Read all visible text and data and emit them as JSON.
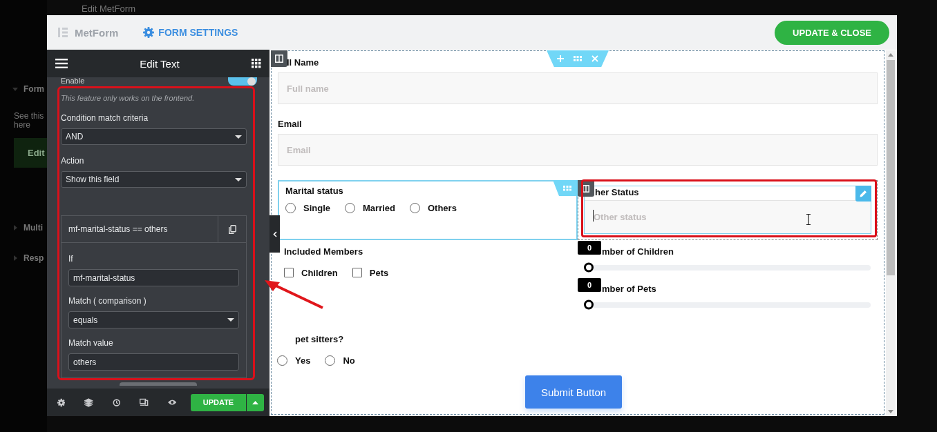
{
  "backdrop": {
    "title": "Edit MetForm",
    "sections": [
      {
        "label": "Form",
        "expanded": true
      },
      {
        "label": "Multi",
        "expanded": false
      },
      {
        "label": "Resp",
        "expanded": false
      }
    ],
    "note": "See this here",
    "button": "Edit"
  },
  "header": {
    "logo": "MetForm",
    "settings": "FORM SETTINGS",
    "action": "UPDATE & CLOSE"
  },
  "panel": {
    "title": "Edit Text",
    "toggle": {
      "label": "Enable",
      "on": true
    },
    "note": "This feature only works on the frontend.",
    "criteria": {
      "label": "Condition match criteria",
      "value": "AND"
    },
    "action": {
      "label": "Action",
      "value": "Show this field"
    },
    "condition": {
      "summary": "mf-marital-status == others",
      "fields": [
        {
          "kind": "input",
          "label": "If",
          "value": "mf-marital-status"
        },
        {
          "kind": "select",
          "label": "Match ( comparison )",
          "value": "equals"
        },
        {
          "kind": "input",
          "label": "Match value",
          "value": "others"
        }
      ]
    },
    "footer": {
      "update": "UPDATE"
    }
  },
  "form": {
    "full_name": {
      "label": "ll Name",
      "placeholder": "Full name"
    },
    "email": {
      "label": "Email",
      "placeholder": "Email"
    },
    "marital": {
      "label": "Marital status",
      "options": [
        {
          "label": "Single",
          "selected": false
        },
        {
          "label": "Married",
          "selected": false
        },
        {
          "label": "Others",
          "selected": false
        }
      ]
    },
    "other_status": {
      "label": "her Status",
      "placeholder": "Other status"
    },
    "members": {
      "label": "Included Members",
      "options": [
        {
          "label": "Children",
          "checked": false
        },
        {
          "label": "Pets",
          "checked": false
        }
      ]
    },
    "sliders": [
      {
        "label": "mber of Children",
        "tooltip": "0",
        "level": 0
      },
      {
        "label": "mber of Pets",
        "tooltip": "0",
        "level": 0
      }
    ],
    "sitters": {
      "label": "pet sitters?",
      "options": [
        {
          "label": "Yes",
          "selected": false
        },
        {
          "label": "No",
          "selected": false
        }
      ]
    },
    "submit": "Submit Button"
  }
}
